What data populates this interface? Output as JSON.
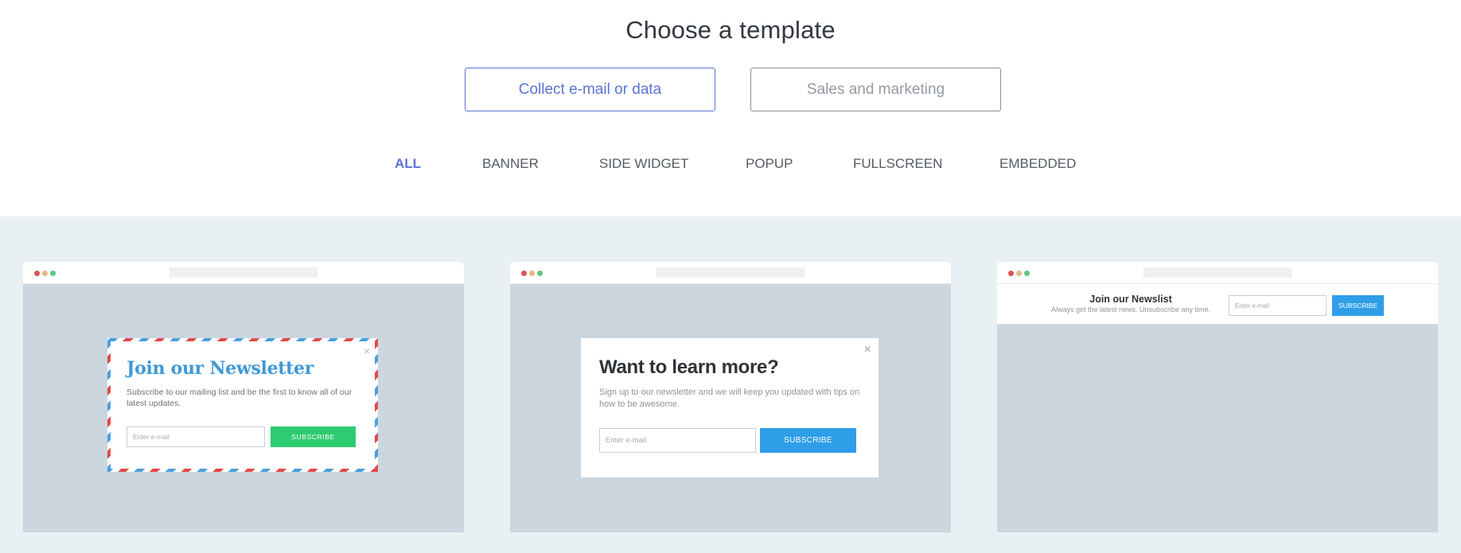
{
  "header": {
    "title": "Choose a template"
  },
  "categories": [
    {
      "label": "Collect e-mail or data",
      "active": true
    },
    {
      "label": "Sales and marketing",
      "active": false
    }
  ],
  "filters": [
    {
      "label": "ALL",
      "active": true
    },
    {
      "label": "BANNER",
      "active": false
    },
    {
      "label": "SIDE WIDGET",
      "active": false
    },
    {
      "label": "POPUP",
      "active": false
    },
    {
      "label": "FULLSCREEN",
      "active": false
    },
    {
      "label": "EMBEDDED",
      "active": false
    }
  ],
  "templates": [
    {
      "title": "Join our Newsletter",
      "text": "Subscribe to our mailing list and be the first to know all of our latest updates.",
      "input_placeholder": "Enter e-mail",
      "button": "SUBSCRIBE",
      "close": "×"
    },
    {
      "title": "Want to learn more?",
      "text": "Sign up to our newsletter and we will keep you updated with tips on how to be awesome.",
      "input_placeholder": "Enter e-mail",
      "button": "SUBSCRIBE",
      "close": "×"
    },
    {
      "title": "Join our Newslist",
      "text": "Always get the latest news. Unsubscribe any time.",
      "input_placeholder": "Enter e-mail",
      "button": "SUBSCRIBE"
    }
  ],
  "colors": {
    "accent": "#5b73d6",
    "gallery_bg": "#e8f0f3",
    "green_button": "#2ecc71",
    "blue_button": "#2f9ee8",
    "newsletter_title": "#3d9ad6"
  },
  "icons": {
    "close": "close-icon",
    "window_controls": "window-dots-icon"
  }
}
